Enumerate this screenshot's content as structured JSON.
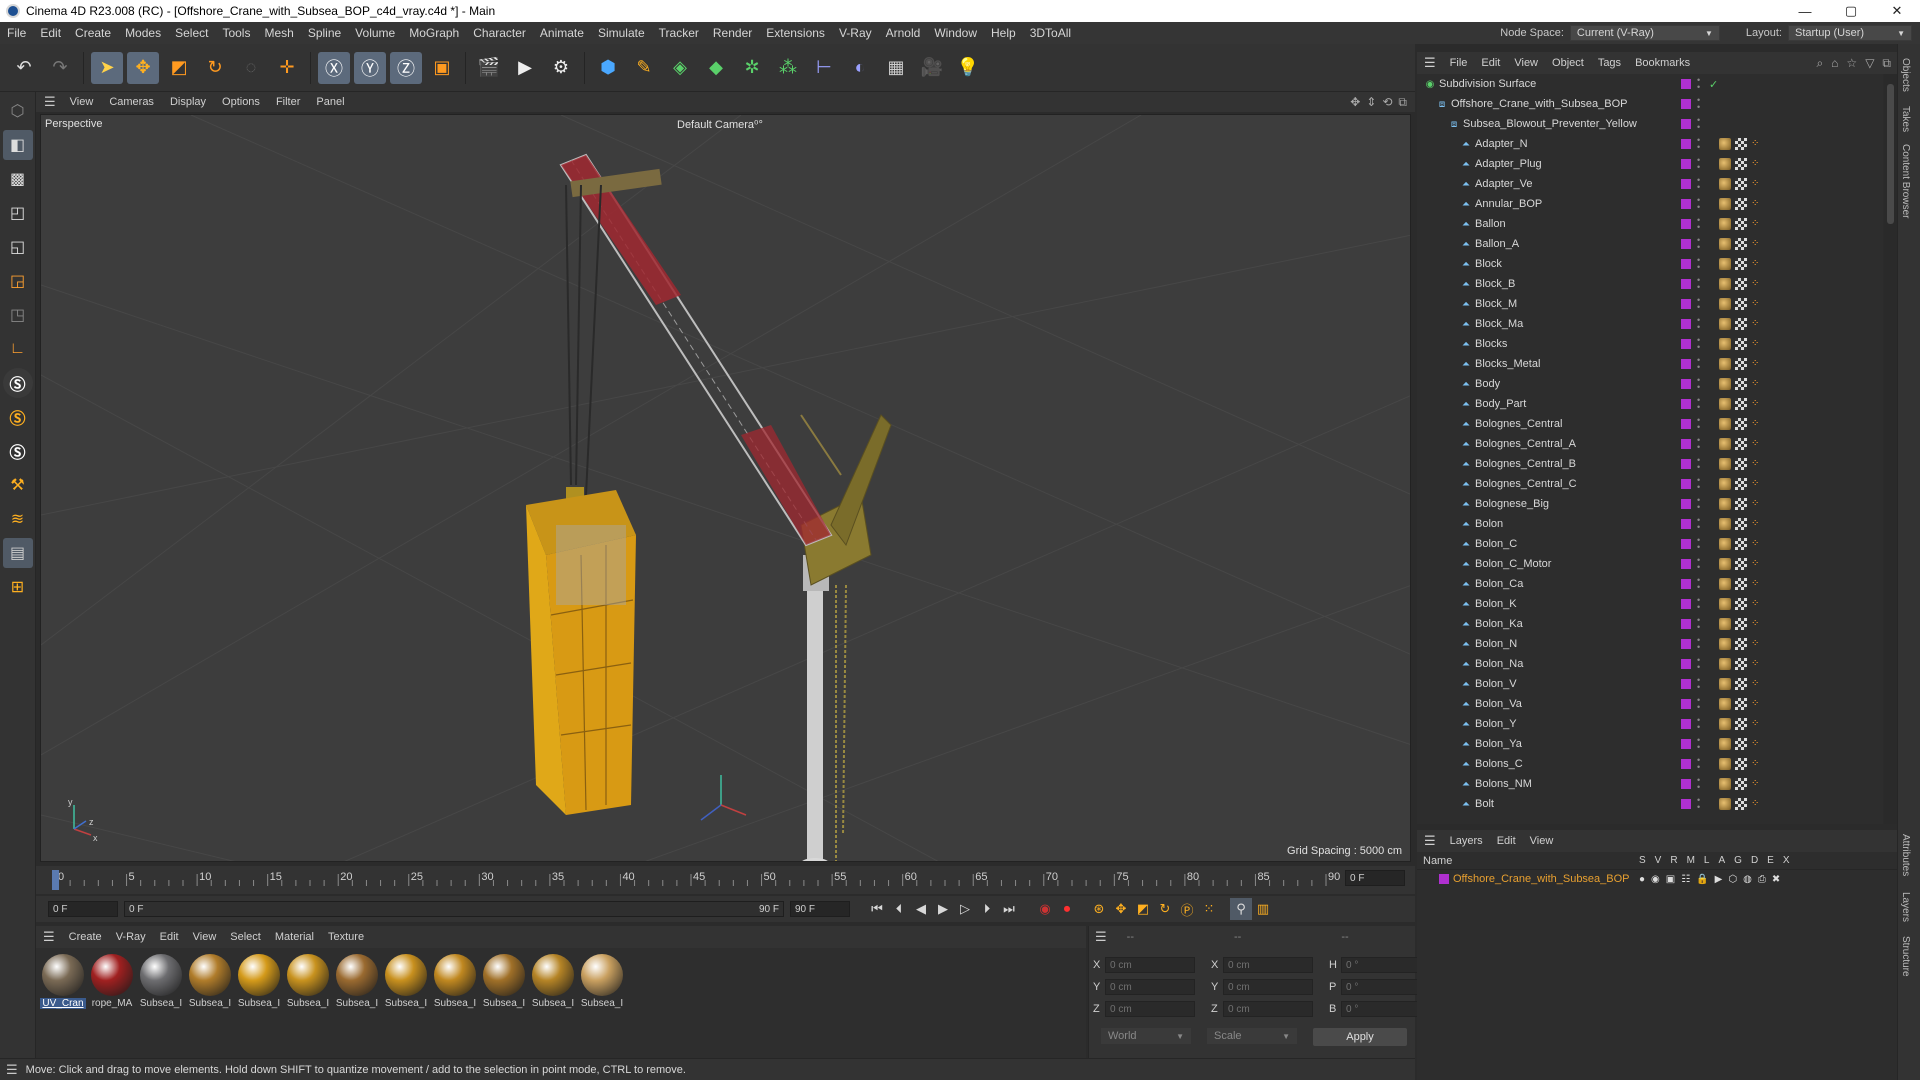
{
  "window": {
    "title": "Cinema 4D R23.008 (RC) - [Offshore_Crane_with_Subsea_BOP_c4d_vray.c4d *] - Main",
    "minimize": "—",
    "maximize": "▢",
    "close": "✕"
  },
  "menubar": {
    "items": [
      "File",
      "Edit",
      "Create",
      "Modes",
      "Select",
      "Tools",
      "Mesh",
      "Spline",
      "Volume",
      "MoGraph",
      "Character",
      "Animate",
      "Simulate",
      "Tracker",
      "Render",
      "Extensions",
      "V-Ray",
      "Arnold",
      "Window",
      "Help",
      "3DToAll"
    ],
    "node_space_label": "Node Space:",
    "node_space_value": "Current (V-Ray)",
    "layout_label": "Layout:",
    "layout_value": "Startup (User)"
  },
  "viewport": {
    "menu": [
      "View",
      "Cameras",
      "Display",
      "Options",
      "Filter",
      "Panel"
    ],
    "label": "Perspective",
    "camera": "Default Camera",
    "camera_suffix": "⁰°",
    "grid_spacing": "Grid Spacing : 5000 cm"
  },
  "timeline": {
    "ticks": [
      "0",
      "5",
      "10",
      "15",
      "20",
      "25",
      "30",
      "35",
      "40",
      "45",
      "50",
      "55",
      "60",
      "65",
      "70",
      "75",
      "80",
      "85",
      "90"
    ],
    "current_frame": "0 F",
    "start_field": "0 F",
    "range_start": "0 F",
    "range_end": "90 F",
    "end_field": "90 F"
  },
  "materials": {
    "menu": [
      "Create",
      "V-Ray",
      "Edit",
      "View",
      "Select",
      "Material",
      "Texture"
    ],
    "items": [
      {
        "label": "UV_Cran",
        "color": "#7a6a55"
      },
      {
        "label": "rope_MA",
        "color": "#a02020"
      },
      {
        "label": "Subsea_I",
        "color": "#6d6d70"
      },
      {
        "label": "Subsea_I",
        "color": "#b07c2a"
      },
      {
        "label": "Subsea_I",
        "color": "#d49a1a"
      },
      {
        "label": "Subsea_I",
        "color": "#c8921e"
      },
      {
        "label": "Subsea_I",
        "color": "#9a6a30"
      },
      {
        "label": "Subsea_I",
        "color": "#c8901e"
      },
      {
        "label": "Subsea_I",
        "color": "#c08820"
      },
      {
        "label": "Subsea_I",
        "color": "#a07028"
      },
      {
        "label": "Subsea_I",
        "color": "#b58426"
      },
      {
        "label": "Subsea_I",
        "color": "#c9a060"
      }
    ]
  },
  "coords": {
    "head": [
      "--",
      "--",
      "--"
    ],
    "rows": [
      {
        "l1": "X",
        "v1": "0 cm",
        "l2": "X",
        "v2": "0 cm",
        "l3": "H",
        "v3": "0 °"
      },
      {
        "l1": "Y",
        "v1": "0 cm",
        "l2": "Y",
        "v2": "0 cm",
        "l3": "P",
        "v3": "0 °"
      },
      {
        "l1": "Z",
        "v1": "0 cm",
        "l2": "Z",
        "v2": "0 cm",
        "l3": "B",
        "v3": "0 °"
      }
    ],
    "mode": "World",
    "scale": "Scale",
    "apply": "Apply"
  },
  "status": "Move: Click and drag to move elements. Hold down SHIFT to quantize movement / add to the selection in point mode, CTRL to remove.",
  "objects": {
    "menu": [
      "File",
      "Edit",
      "View",
      "Object",
      "Tags",
      "Bookmarks"
    ],
    "top": [
      {
        "name": "Subdivision Surface",
        "indent": 0
      },
      {
        "name": "Offshore_Crane_with_Subsea_BOP",
        "indent": 1
      },
      {
        "name": "Subsea_Blowout_Preventer_Yellow",
        "indent": 2
      }
    ],
    "children": [
      "Adapter_N",
      "Adapter_Plug",
      "Adapter_Ve",
      "Annular_BOP",
      "Ballon",
      "Ballon_A",
      "Block",
      "Block_B",
      "Block_M",
      "Block_Ma",
      "Blocks",
      "Blocks_Metal",
      "Body",
      "Body_Part",
      "Bolognes_Central",
      "Bolognes_Central_A",
      "Bolognes_Central_B",
      "Bolognes_Central_C",
      "Bolognese_Big",
      "Bolon",
      "Bolon_C",
      "Bolon_C_Motor",
      "Bolon_Ca",
      "Bolon_K",
      "Bolon_Ka",
      "Bolon_N",
      "Bolon_Na",
      "Bolon_V",
      "Bolon_Va",
      "Bolon_Y",
      "Bolon_Ya",
      "Bolons_C",
      "Bolons_NM",
      "Bolt"
    ]
  },
  "layers": {
    "menu": [
      "Layers",
      "Edit",
      "View"
    ],
    "name_header": "Name",
    "columns": [
      "S",
      "V",
      "R",
      "M",
      "L",
      "A",
      "G",
      "D",
      "E",
      "X"
    ],
    "row_name": "Offshore_Crane_with_Subsea_BOP"
  },
  "side_tabs": [
    "Objects",
    "Takes",
    "Content Browser",
    "Attributes",
    "Layers",
    "Structure"
  ]
}
